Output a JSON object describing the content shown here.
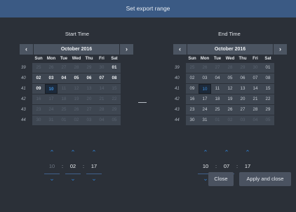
{
  "dialog": {
    "title": "Set export range"
  },
  "start": {
    "title": "Start Time",
    "month_label": "October 2016",
    "weekdays": [
      "Sun",
      "Mon",
      "Tue",
      "Wed",
      "Thu",
      "Fri",
      "Sat"
    ],
    "weeks": [
      {
        "wk": "39",
        "days": [
          {
            "d": "25",
            "o": true
          },
          {
            "d": "26",
            "o": true
          },
          {
            "d": "27",
            "o": true
          },
          {
            "d": "28",
            "o": true
          },
          {
            "d": "29",
            "o": true
          },
          {
            "d": "30",
            "o": true
          },
          {
            "d": "01"
          }
        ]
      },
      {
        "wk": "40",
        "days": [
          {
            "d": "02"
          },
          {
            "d": "03"
          },
          {
            "d": "04"
          },
          {
            "d": "05"
          },
          {
            "d": "06"
          },
          {
            "d": "07"
          },
          {
            "d": "08"
          }
        ]
      },
      {
        "wk": "41",
        "days": [
          {
            "d": "09"
          },
          {
            "d": "10",
            "s": true
          },
          {
            "d": "11",
            "o": true
          },
          {
            "d": "12",
            "o": true
          },
          {
            "d": "13",
            "o": true
          },
          {
            "d": "14",
            "o": true
          },
          {
            "d": "15",
            "o": true
          }
        ]
      },
      {
        "wk": "42",
        "days": [
          {
            "d": "16",
            "o": true
          },
          {
            "d": "17",
            "o": true
          },
          {
            "d": "18",
            "o": true
          },
          {
            "d": "19",
            "o": true
          },
          {
            "d": "20",
            "o": true
          },
          {
            "d": "21",
            "o": true
          },
          {
            "d": "22",
            "o": true
          }
        ]
      },
      {
        "wk": "43",
        "days": [
          {
            "d": "23",
            "o": true
          },
          {
            "d": "24",
            "o": true
          },
          {
            "d": "25",
            "o": true
          },
          {
            "d": "26",
            "o": true
          },
          {
            "d": "27",
            "o": true
          },
          {
            "d": "28",
            "o": true
          },
          {
            "d": "29",
            "o": true
          }
        ]
      },
      {
        "wk": "44",
        "days": [
          {
            "d": "30",
            "o": true
          },
          {
            "d": "31",
            "o": true
          },
          {
            "d": "01",
            "o": true
          },
          {
            "d": "02",
            "o": true
          },
          {
            "d": "03",
            "o": true
          },
          {
            "d": "04",
            "o": true
          },
          {
            "d": "05",
            "o": true
          }
        ]
      }
    ],
    "hour": "10",
    "minute": "02",
    "second": "17"
  },
  "end": {
    "title": "End Time",
    "month_label": "October 2016",
    "weekdays": [
      "Sun",
      "Mon",
      "Tue",
      "Wed",
      "Thu",
      "Fri",
      "Sat"
    ],
    "weeks": [
      {
        "wk": "39",
        "days": [
          {
            "d": "25",
            "o": true
          },
          {
            "d": "26",
            "o": true
          },
          {
            "d": "27",
            "o": true
          },
          {
            "d": "28",
            "o": true
          },
          {
            "d": "29",
            "o": true
          },
          {
            "d": "30",
            "o": true
          },
          {
            "d": "01"
          }
        ]
      },
      {
        "wk": "40",
        "days": [
          {
            "d": "02"
          },
          {
            "d": "03"
          },
          {
            "d": "04"
          },
          {
            "d": "05"
          },
          {
            "d": "06"
          },
          {
            "d": "07"
          },
          {
            "d": "08"
          }
        ]
      },
      {
        "wk": "41",
        "days": [
          {
            "d": "09"
          },
          {
            "d": "10",
            "s": true
          },
          {
            "d": "11"
          },
          {
            "d": "12"
          },
          {
            "d": "13"
          },
          {
            "d": "14"
          },
          {
            "d": "15"
          }
        ]
      },
      {
        "wk": "42",
        "days": [
          {
            "d": "16"
          },
          {
            "d": "17"
          },
          {
            "d": "18"
          },
          {
            "d": "19"
          },
          {
            "d": "20"
          },
          {
            "d": "21"
          },
          {
            "d": "22"
          }
        ]
      },
      {
        "wk": "43",
        "days": [
          {
            "d": "23"
          },
          {
            "d": "24"
          },
          {
            "d": "25"
          },
          {
            "d": "26"
          },
          {
            "d": "27"
          },
          {
            "d": "28"
          },
          {
            "d": "29"
          }
        ]
      },
      {
        "wk": "44",
        "days": [
          {
            "d": "30"
          },
          {
            "d": "31"
          },
          {
            "d": "01",
            "o": true
          },
          {
            "d": "02",
            "o": true
          },
          {
            "d": "03",
            "o": true
          },
          {
            "d": "04",
            "o": true
          },
          {
            "d": "05",
            "o": true
          }
        ]
      }
    ],
    "hour": "10",
    "minute": "07",
    "second": "17"
  },
  "icons": {
    "prev": "chevron-left-icon",
    "next": "chevron-right-icon",
    "up": "chevron-up-icon",
    "down": "chevron-down-icon"
  },
  "glyphs": {
    "prev": "‹",
    "next": "›",
    "up": "⌃",
    "down": "⌄",
    "colon": ":"
  },
  "buttons": {
    "close": "Close",
    "apply": "Apply and close"
  },
  "colors": {
    "titlebar": "#3b5a84",
    "background": "#2b3038",
    "accent": "#2f7fd0",
    "selected_day": "#3d8fe0"
  }
}
